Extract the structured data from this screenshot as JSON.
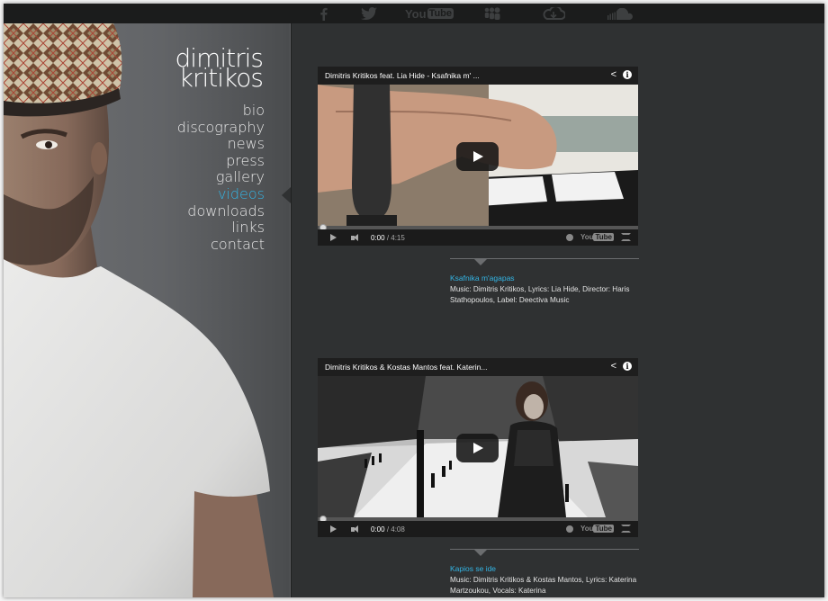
{
  "social": [
    {
      "name": "facebook-icon",
      "glyph": "f"
    },
    {
      "name": "twitter-icon",
      "glyph": "bird"
    },
    {
      "name": "youtube-icon",
      "label": "You",
      "label2": "Tube"
    },
    {
      "name": "myspace-icon",
      "glyph": "people"
    },
    {
      "name": "cloud-icon",
      "glyph": "cloud"
    },
    {
      "name": "soundcloud-icon",
      "glyph": "soundcloud"
    }
  ],
  "logo": {
    "line1": "dimitris",
    "line2": "kritikos"
  },
  "nav": {
    "items": [
      "bio",
      "discography",
      "news",
      "press",
      "gallery",
      "videos",
      "downloads",
      "links",
      "contact"
    ],
    "active": "videos"
  },
  "colors": {
    "accent": "#33b5e5",
    "background": "#2f3132",
    "topbar": "#1b1c1c"
  },
  "videos": [
    {
      "title": "Dimitris Kritikos feat. Lia Hide - Ksafnika m' ...",
      "current_time": "0:00",
      "duration": "/ 4:15",
      "caption_title": "Ksafnika m'agapas",
      "caption_desc": "Music: Dimitris Kritikos, Lyrics: Lia Hide, Director: Haris Stathopoulos, Label: Deectiva Music"
    },
    {
      "title": "Dimitris Kritikos & Kostas Mantos feat. Katerin...",
      "current_time": "0:00",
      "duration": "/ 4:08",
      "caption_title": "Kapios se ide",
      "caption_desc": "Music: Dimitris Kritikos & Kostas Mantos, Lyrics: Katerina Martzoukou, Vocals: Katerina"
    }
  ]
}
